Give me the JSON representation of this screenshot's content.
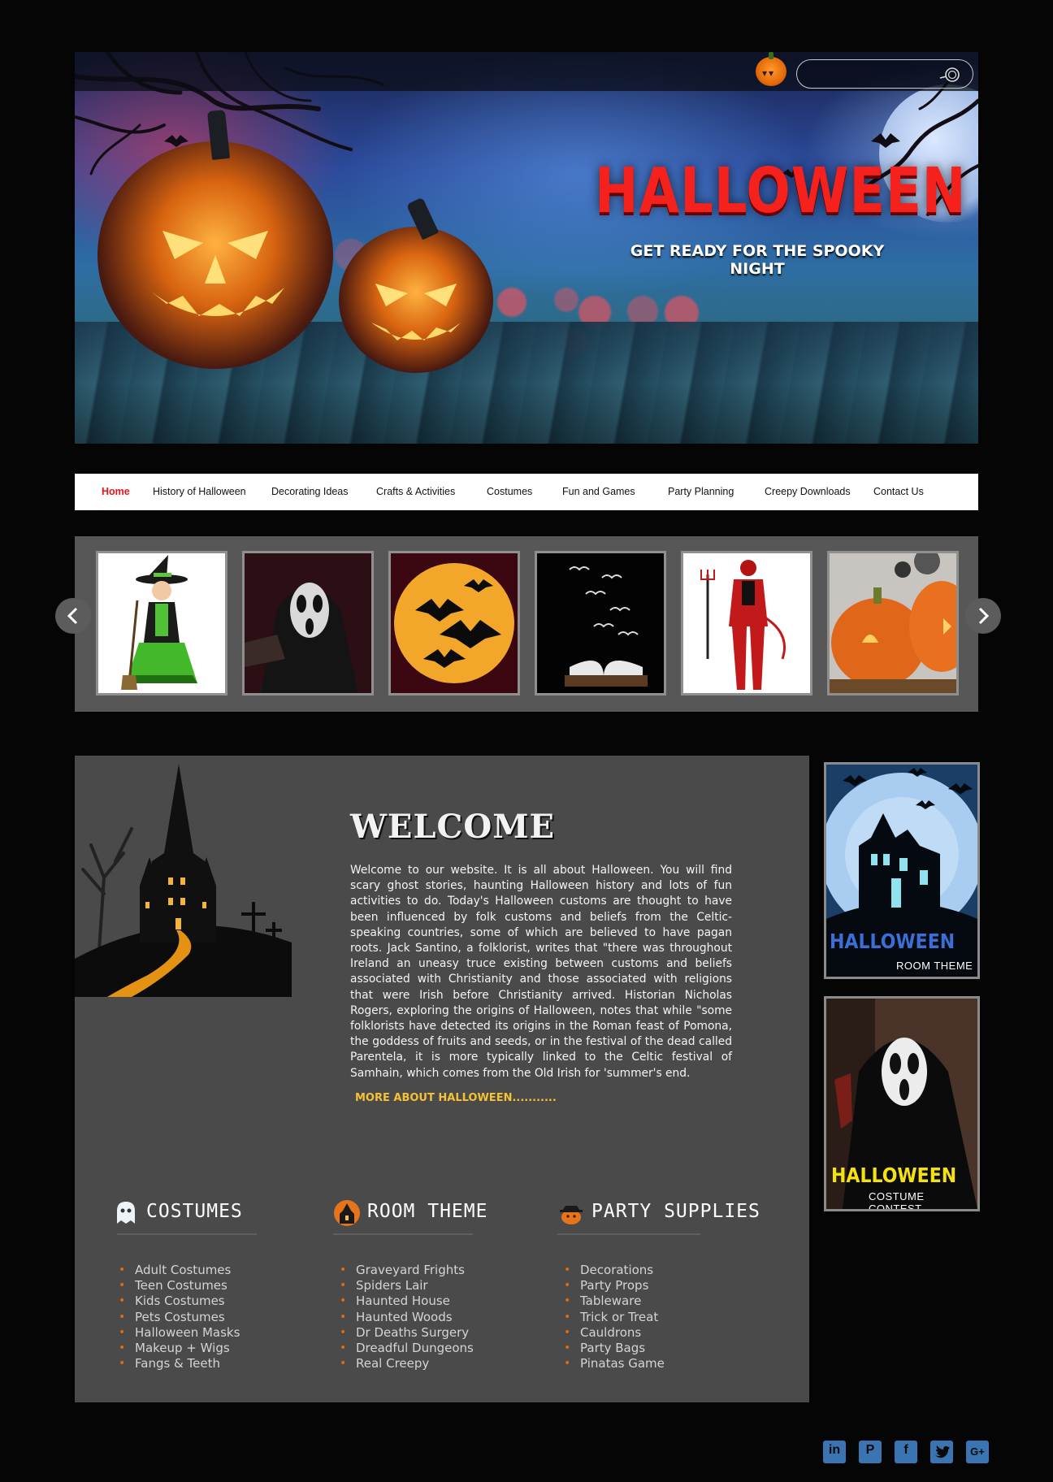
{
  "hero": {
    "title": "HALLOWEEN",
    "subtitle": "GET READY FOR THE SPOOKY NIGHT",
    "search_placeholder": ""
  },
  "nav": {
    "items": [
      {
        "label": "Home",
        "active": true
      },
      {
        "label": "History of Halloween"
      },
      {
        "label": "Decorating Ideas"
      },
      {
        "label": "Crafts & Activities"
      },
      {
        "label": "Costumes"
      },
      {
        "label": "Fun and Games"
      },
      {
        "label": "Party Planning"
      },
      {
        "label": "Creepy Downloads"
      },
      {
        "label": "Contact Us"
      }
    ]
  },
  "carousel": {
    "thumbs": [
      "witch-costume",
      "ghostface-mask",
      "bats-moon",
      "book-birds",
      "devil-costume",
      "carved-pumpkins"
    ]
  },
  "welcome": {
    "title": "WELCOME",
    "body": "Welcome to our website. It is all about Halloween. You will find scary ghost stories, haunting Halloween history and lots of fun activities to do. Today's Halloween customs are thought to have been influenced by folk customs and beliefs from the Celtic-speaking countries, some of which are believed to have pagan roots. Jack Santino, a folklorist, writes that \"there was throughout Ireland an uneasy truce existing between customs and beliefs associated with Christianity and those associated with religions that were Irish before Christianity arrived. Historian Nicholas Rogers, exploring the origins of Halloween, notes that while \"some folklorists have detected its origins in the Roman feast of Pomona, the goddess of fruits and seeds, or in the festival of the dead called Parentela, it is more typically linked to the Celtic festival of Samhain, which comes from the Old Irish for 'summer's end.",
    "more_link": "MORE ABOUT HALLOWEEN..........."
  },
  "columns": [
    {
      "title": "COSTUMES",
      "icon": "ghost-icon",
      "items": [
        "Adult Costumes",
        "Teen Costumes",
        "Kids Costumes",
        "Pets Costumes",
        "Halloween Masks",
        "Makeup + Wigs",
        "Fangs & Teeth"
      ]
    },
    {
      "title": "ROOM THEME",
      "icon": "haunted-house-icon",
      "items": [
        "Graveyard Frights",
        "Spiders Lair",
        "Haunted House",
        "Haunted Woods",
        "Dr Deaths Surgery",
        "Dreadful Dungeons",
        "Real Creepy"
      ]
    },
    {
      "title": "PARTY SUPPLIES",
      "icon": "pumpkin-hat-icon",
      "items": [
        "Decorations",
        "Party Props",
        "Tableware",
        "Trick or Treat",
        "Cauldrons",
        "Party Bags",
        "Pinatas Game"
      ]
    }
  ],
  "side_cards": [
    {
      "title": "HALLOWEEN",
      "subtitle": "ROOM THEME",
      "title_color": "#3a6fd8"
    },
    {
      "title": "HALLOWEEN",
      "subtitle": "COSTUME CONTEST",
      "title_color": "#f5e20a"
    }
  ],
  "social": [
    "in",
    "P",
    "f",
    "twitter",
    "G+"
  ],
  "colors": {
    "accent_red": "#e3161c",
    "bullet_orange": "#e06a10",
    "link_yellow": "#f4c234",
    "social_blue": "#3a74b3"
  }
}
